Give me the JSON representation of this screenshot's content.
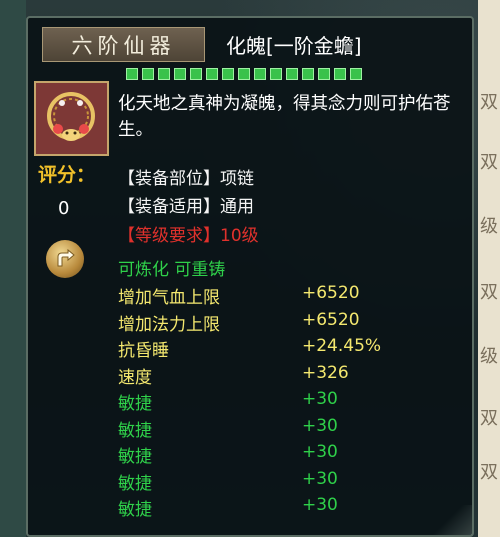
{
  "item": {
    "grade_tag": "六阶仙器",
    "name": "化魄[一阶金蟾]",
    "quality_level": 15,
    "description": "化天地之真神为凝魄，得其念力则可护佑苍生。",
    "score_label": "评分：",
    "score_value": "0",
    "icon": "gold-toad-necklace-icon"
  },
  "properties": {
    "slot": "【装备部位】项链",
    "usage": "【装备适用】通用",
    "level_req": "【等级要求】10级",
    "refine": "可炼化 可重铸"
  },
  "stats": [
    {
      "name": "增加气血上限",
      "value": "+6520",
      "color": "#f4e86f"
    },
    {
      "name": "增加法力上限",
      "value": "+6520",
      "color": "#f4e86f"
    },
    {
      "name": "抗昏睡",
      "value": "+24.45%",
      "color": "#f4e86f"
    },
    {
      "name": "速度",
      "value": "+326",
      "color": "#f4e86f"
    },
    {
      "name": "敏捷",
      "value": "+30",
      "color": "#2fd04a"
    },
    {
      "name": "敏捷",
      "value": "+30",
      "color": "#2fd04a"
    },
    {
      "name": "敏捷",
      "value": "+30",
      "color": "#2fd04a"
    },
    {
      "name": "敏捷",
      "value": "+30",
      "color": "#2fd04a"
    },
    {
      "name": "敏捷",
      "value": "+30",
      "color": "#2fd04a"
    }
  ],
  "background": {
    "right_chars": [
      "双",
      "双",
      "级",
      "双",
      "级",
      "双",
      "双"
    ]
  }
}
